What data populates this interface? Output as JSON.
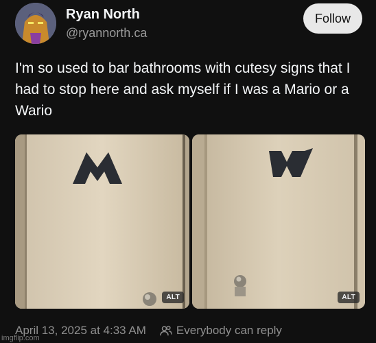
{
  "author": {
    "name": "Ryan North",
    "handle": "@ryannorth.ca"
  },
  "follow_button": {
    "label": "Follow"
  },
  "post": {
    "text": "I'm so used to bar bathrooms with cutesy signs that I had to stop here and ask myself if I was a Mario or a Wario"
  },
  "media": [
    {
      "letter": "M",
      "alt_badge": "ALT"
    },
    {
      "letter": "W",
      "alt_badge": "ALT"
    }
  ],
  "footer": {
    "timestamp": "April 13, 2025 at 4:33 AM",
    "reply_setting": "Everybody can reply"
  },
  "watermark": "imgflip.com",
  "icons": {
    "avatar": "avatar",
    "reply_setting": "people-icon"
  },
  "colors": {
    "background": "#101010",
    "text": "#f3f5f7",
    "muted": "#8f8f8f",
    "follow_bg": "#e8e8e8",
    "door": "#d9cdb8",
    "letter": "#2a2d33"
  }
}
